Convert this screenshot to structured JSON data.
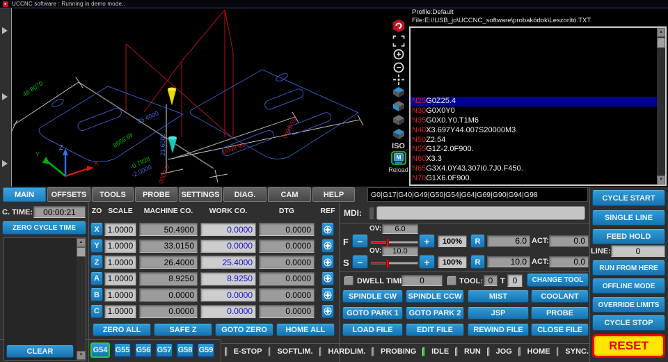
{
  "window": {
    "title": "UCCNC software : Running in demo mode.."
  },
  "viewer": {
    "profile_line": "Profile:Default",
    "file_line": "File:E:\\!USB_jo\\UCCNC_software\\probakódok\\Leszorító.TXT",
    "iso_label": "ISO",
    "reload_label": "Reload",
    "m_icon_label": "M",
    "axis_labels": {
      "x": "X",
      "y": "Y",
      "z": "Z"
    },
    "dim_labels": {
      "d48": "48.8070",
      "d49": "49.5998",
      "d254": "25.4000",
      "d216": "21.6000",
      "dm07928": "-0.7928",
      "dm2": "-2.0000",
      "d568": "56.8000",
      "d556": "55.6000",
      "dm06": "-0.6000"
    }
  },
  "gcode": {
    "status_line": "G0|G17|G40|G49|G50|G54|G64|G69|G90|G94|G98",
    "lines": [
      {
        "n": "N25",
        "code": "G0Z25.4",
        "highlight": true
      },
      {
        "n": "N30",
        "code": "G0X0Y0",
        "highlight": false
      },
      {
        "n": "N35",
        "code": "G0X0.Y0.T1M6",
        "highlight": false
      },
      {
        "n": "N40",
        "code": "X3.697Y44.007S20000M3",
        "highlight": false
      },
      {
        "n": "N50",
        "code": "Z2.54",
        "highlight": false
      },
      {
        "n": "N55",
        "code": "G1Z-2.0F900.",
        "highlight": false
      },
      {
        "n": "N60",
        "code": "X3.3",
        "highlight": false
      },
      {
        "n": "N65",
        "code": "G3X4.0Y43.307I0.7J0.F450.",
        "highlight": false
      },
      {
        "n": "N70",
        "code": "G1X6.0F900.",
        "highlight": false
      }
    ]
  },
  "tabs": [
    {
      "label": "MAIN",
      "active": true
    },
    {
      "label": "OFFSETS",
      "active": false
    },
    {
      "label": "TOOLS",
      "active": false
    },
    {
      "label": "PROBE",
      "active": false
    },
    {
      "label": "SETTINGS",
      "active": false
    },
    {
      "label": "DIAG.",
      "active": false
    },
    {
      "label": "CAM",
      "active": false
    },
    {
      "label": "HELP",
      "active": false
    }
  ],
  "cycle": {
    "time_label": "C. TIME:",
    "time_value": "00:00:21",
    "zero_button": "ZERO CYCLE TIME",
    "clear_button": "CLEAR"
  },
  "dro": {
    "headers": {
      "zo": "ZO",
      "scale": "SCALE",
      "machine": "MACHINE CO.",
      "work": "WORK CO.",
      "dtg": "DTG",
      "ref": "REF"
    },
    "rows": [
      {
        "axis": "X",
        "scale": "1.0000",
        "machine": "50.4900",
        "work": "0.0000",
        "dtg": "0.0000"
      },
      {
        "axis": "Y",
        "scale": "1.0000",
        "machine": "33.0150",
        "work": "0.0000",
        "dtg": "0.0000"
      },
      {
        "axis": "Z",
        "scale": "1.0000",
        "machine": "26.4000",
        "work": "25.4000",
        "dtg": "0.0000"
      },
      {
        "axis": "A",
        "scale": "1.0000",
        "machine": "8.9250",
        "work": "8.9250",
        "dtg": "0.0000"
      },
      {
        "axis": "B",
        "scale": "1.0000",
        "machine": "0.0000",
        "work": "0.0000",
        "dtg": "0.0000"
      },
      {
        "axis": "C",
        "scale": "1.0000",
        "machine": "0.0000",
        "work": "0.0000",
        "dtg": "0.0000"
      }
    ],
    "action_buttons": [
      "ZERO ALL",
      "SAFE Z",
      "GOTO ZERO",
      "HOME ALL"
    ],
    "offset_buttons": [
      {
        "label": "G54",
        "active": true
      },
      {
        "label": "G55",
        "active": false
      },
      {
        "label": "G56",
        "active": false
      },
      {
        "label": "G57",
        "active": false
      },
      {
        "label": "G58",
        "active": false
      },
      {
        "label": "G59",
        "active": false
      }
    ]
  },
  "mdi": {
    "label": "MDI:"
  },
  "overrides": {
    "feed": {
      "axis_label": "F",
      "ov_label": "OV:",
      "ov_value": "6.0",
      "percent": "100%",
      "reset": "R",
      "value": "6.0",
      "act_label": "ACT:",
      "act_value": "0.0"
    },
    "spindle": {
      "axis_label": "S",
      "ov_label": "OV:",
      "ov_value": "10.0",
      "percent": "100%",
      "reset": "R",
      "value": "10.0",
      "act_label": "ACT:",
      "act_value": "0.0"
    }
  },
  "tool": {
    "dwell_label": "DWELL TIME:",
    "dwell_value": "0",
    "tool_label": "TOOL:",
    "tool_value": "0",
    "t_label": "T",
    "t_value": "0",
    "change_button": "CHANGE TOOL"
  },
  "machine_buttons": [
    [
      "SPINDLE CW",
      "SPINDLE CCW",
      "MIST",
      "COOLANT"
    ],
    [
      "GOTO PARK 1",
      "GOTO PARK 2",
      "JSP",
      "PROBE"
    ],
    [
      "LOAD FILE",
      "EDIT FILE",
      "REWIND FILE",
      "CLOSE FILE"
    ]
  ],
  "run_panel": {
    "cycle_start": "CYCLE START",
    "single_line": "SINGLE LINE",
    "feed_hold": "FEED HOLD",
    "line_label": "LINE:",
    "line_value": "0",
    "run_from_here": "RUN FROM HERE",
    "offline_mode": "OFFLINE MODE",
    "override_limits": "OVERRIDE LIMITS",
    "cycle_stop": "CYCLE STOP",
    "reset": "RESET"
  },
  "status_leds": [
    {
      "label": "E-STOP",
      "on": false
    },
    {
      "label": "SOFTLIM.",
      "on": false
    },
    {
      "label": "HARDLIM.",
      "on": false
    },
    {
      "label": "PROBING",
      "on": false
    },
    {
      "label": "IDLE",
      "on": true
    },
    {
      "label": "RUN",
      "on": false
    },
    {
      "label": "JOG",
      "on": false
    },
    {
      "label": "HOME",
      "on": false
    },
    {
      "label": "SYNC.",
      "on": false
    }
  ],
  "colors": {
    "accent_blue": "#1d86c9",
    "active_tab": "#2d96d8",
    "reset_yellow": "#ffe600",
    "reset_red": "#e80000",
    "led_green": "#35d435",
    "work_value_blue": "#1414d2",
    "gcode_number_red": "#d42020",
    "highlight_blue": "#000092"
  }
}
